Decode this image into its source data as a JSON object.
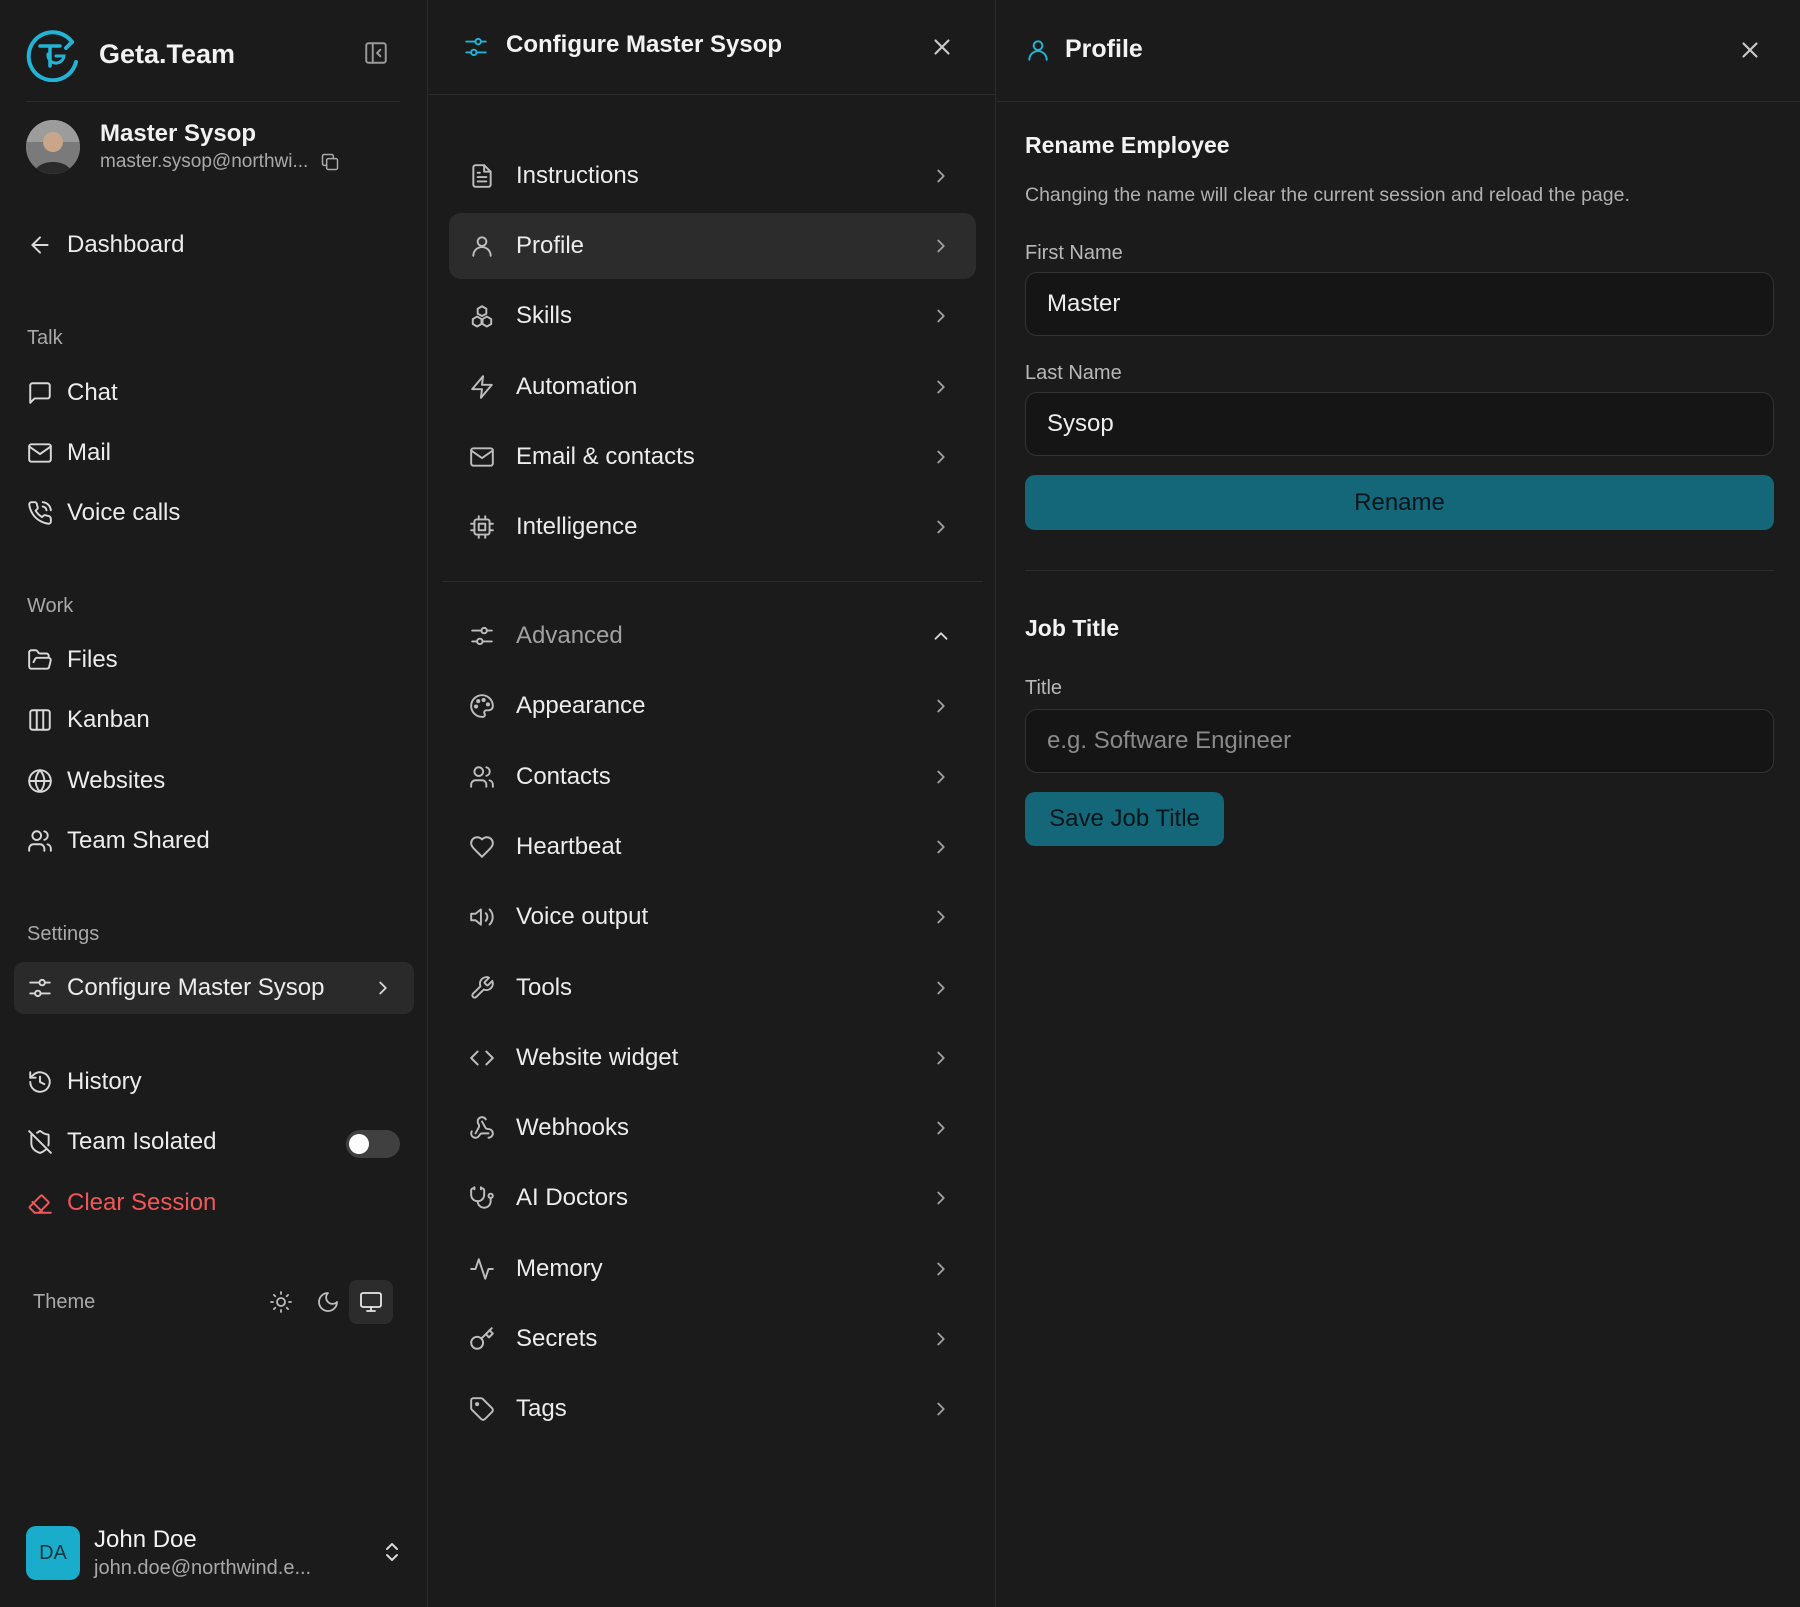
{
  "brand": {
    "name": "Geta.Team"
  },
  "current_employee": {
    "name": "Master Sysop",
    "email": "master.sysop@northwi..."
  },
  "sidebar": {
    "dashboard": "Dashboard",
    "sections": {
      "talk": "Talk",
      "work": "Work",
      "settings": "Settings"
    },
    "talk_items": [
      "Chat",
      "Mail",
      "Voice calls"
    ],
    "work_items": [
      "Files",
      "Kanban",
      "Websites",
      "Team Shared"
    ],
    "configure_label": "Configure Master Sysop",
    "history": "History",
    "team_isolated": "Team Isolated",
    "team_isolated_on": false,
    "clear_session": "Clear Session",
    "theme_label": "Theme",
    "theme_selected": "system"
  },
  "user": {
    "initials": "DA",
    "name": "John Doe",
    "email": "john.doe@northwind.e..."
  },
  "config_panel": {
    "title": "Configure Master Sysop",
    "items": [
      "Instructions",
      "Profile",
      "Skills",
      "Automation",
      "Email & contacts",
      "Intelligence"
    ],
    "active": "Profile",
    "advanced_label": "Advanced",
    "advanced_items": [
      "Appearance",
      "Contacts",
      "Heartbeat",
      "Voice output",
      "Tools",
      "Website widget",
      "Webhooks",
      "AI Doctors",
      "Memory",
      "Secrets",
      "Tags"
    ]
  },
  "profile_panel": {
    "title": "Profile",
    "rename": {
      "heading": "Rename Employee",
      "description": "Changing the name will clear the current session and reload the page.",
      "first_name_label": "First Name",
      "first_name_value": "Master",
      "last_name_label": "Last Name",
      "last_name_value": "Sysop",
      "button": "Rename"
    },
    "job": {
      "heading": "Job Title",
      "title_label": "Title",
      "title_placeholder": "e.g. Software Engineer",
      "title_value": "",
      "button": "Save Job Title"
    }
  },
  "colors": {
    "accent": "#22b4d6",
    "button": "#136779",
    "danger": "#f0575b",
    "background": "#1b1b1b"
  }
}
